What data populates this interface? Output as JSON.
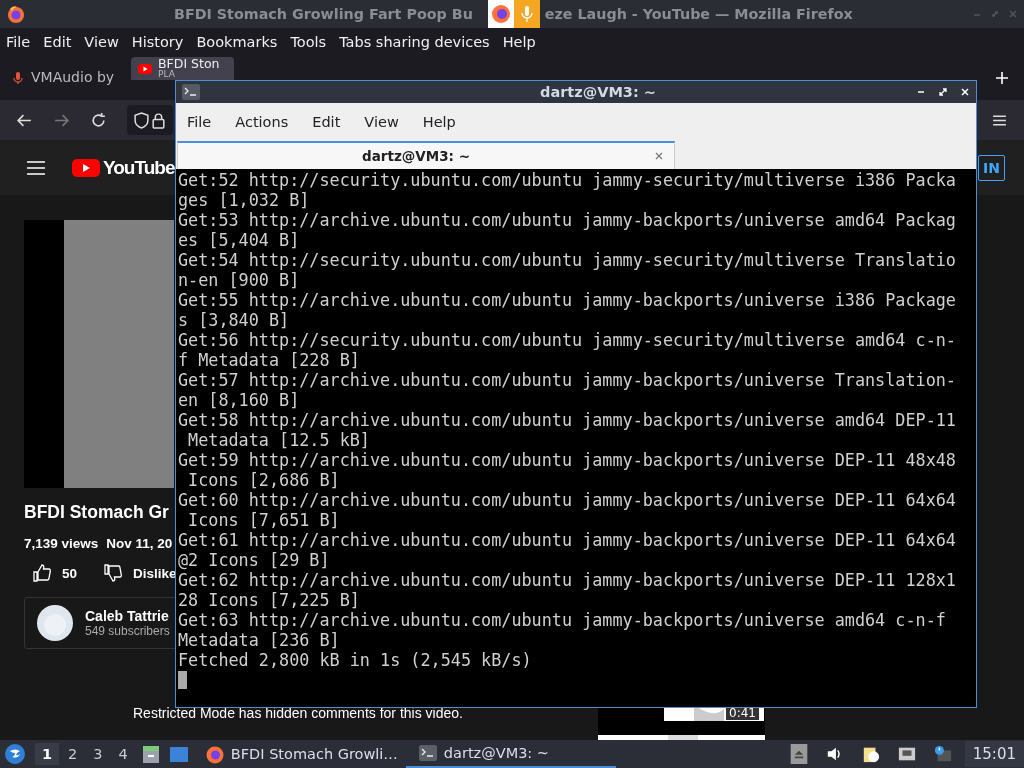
{
  "firefox": {
    "title_start": "BFDI Stomach Growling Fart Poop Bu",
    "title_end": "eze Laugh - YouTube — Mozilla Firefox",
    "menu": [
      "File",
      "Edit",
      "View",
      "History",
      "Bookmarks",
      "Tools",
      "Tabs sharing devices",
      "Help"
    ],
    "tabs": [
      {
        "label": "VMAudio by",
        "kind": "mic",
        "selected": false
      },
      {
        "label": "BFDI Ston",
        "sub": "PLA",
        "kind": "youtube",
        "selected": true
      }
    ],
    "sign_in": "IN"
  },
  "youtube": {
    "logo": "YouTube",
    "video_title": "BFDI Stomach Gr",
    "views": "7,139 views",
    "date": "Nov 11, 20",
    "likes": "50",
    "dislike": "Dislike",
    "channel": "Caleb Tattrie",
    "subscribers": "549 subscribers",
    "restricted_note": "Restricted Mode has hidden comments for this video.",
    "thumb_duration": "0:41"
  },
  "terminal": {
    "title": "dartz@VM3: ~",
    "menu": [
      "File",
      "Actions",
      "Edit",
      "View",
      "Help"
    ],
    "tab": "dartz@VM3: ~",
    "lines": [
      "Get:52 http://security.ubuntu.com/ubuntu jammy-security/multiverse i386 Packa",
      "ges [1,032 B]",
      "Get:53 http://archive.ubuntu.com/ubuntu jammy-backports/universe amd64 Packag",
      "es [5,404 B]",
      "Get:54 http://security.ubuntu.com/ubuntu jammy-security/multiverse Translatio",
      "n-en [900 B]",
      "Get:55 http://archive.ubuntu.com/ubuntu jammy-backports/universe i386 Package",
      "s [3,840 B]",
      "Get:56 http://security.ubuntu.com/ubuntu jammy-security/multiverse amd64 c-n-",
      "f Metadata [228 B]",
      "Get:57 http://archive.ubuntu.com/ubuntu jammy-backports/universe Translation-",
      "en [8,160 B]",
      "Get:58 http://archive.ubuntu.com/ubuntu jammy-backports/universe amd64 DEP-11",
      " Metadata [12.5 kB]",
      "Get:59 http://archive.ubuntu.com/ubuntu jammy-backports/universe DEP-11 48x48",
      " Icons [2,686 B]",
      "Get:60 http://archive.ubuntu.com/ubuntu jammy-backports/universe DEP-11 64x64",
      " Icons [7,651 B]",
      "Get:61 http://archive.ubuntu.com/ubuntu jammy-backports/universe DEP-11 64x64",
      "@2 Icons [29 B]",
      "Get:62 http://archive.ubuntu.com/ubuntu jammy-backports/universe DEP-11 128x1",
      "28 Icons [7,225 B]",
      "Get:63 http://archive.ubuntu.com/ubuntu jammy-backports/universe amd64 c-n-f",
      "Metadata [236 B]",
      "Fetched 2,800 kB in 1s (2,545 kB/s)"
    ]
  },
  "taskbar": {
    "workspaces": [
      {
        "label": "1",
        "selected": true
      },
      {
        "label": "2",
        "selected": false
      },
      {
        "label": "3",
        "selected": false
      },
      {
        "label": "4",
        "selected": false
      }
    ],
    "tasks": [
      {
        "label": "BFDI Stomach Growli…",
        "kind": "firefox",
        "selected": false
      },
      {
        "label": "dartz@VM3: ~",
        "kind": "terminal",
        "selected": true
      }
    ],
    "clock": "15:01"
  }
}
